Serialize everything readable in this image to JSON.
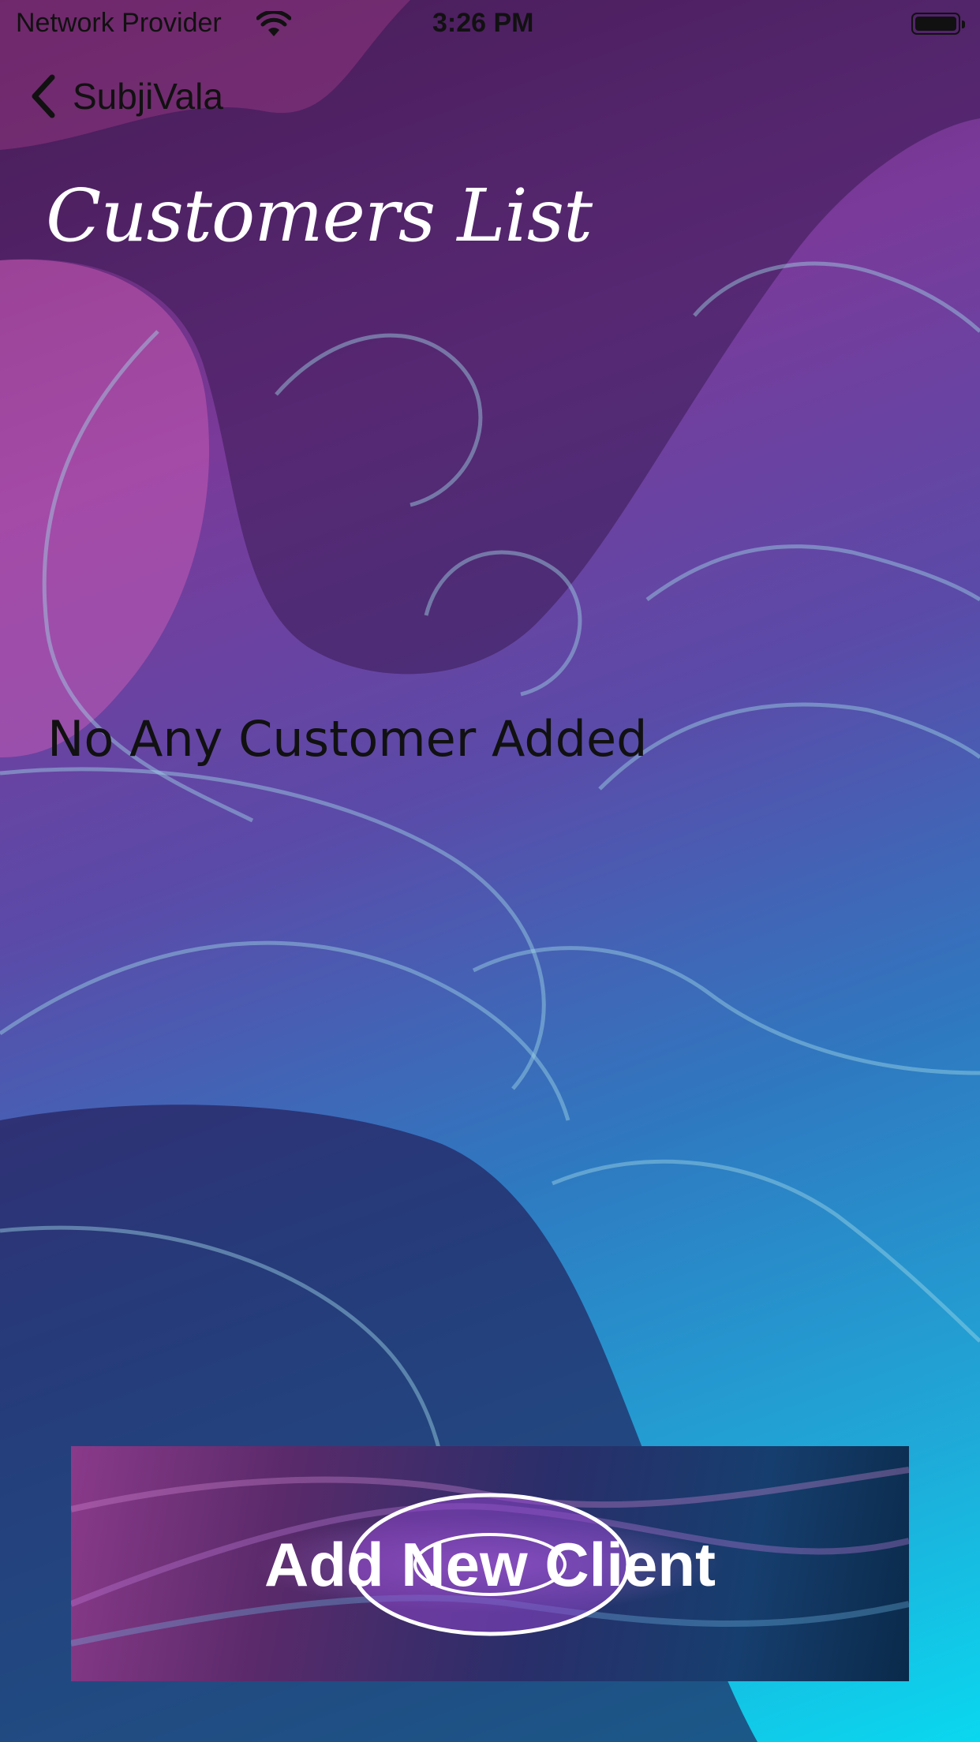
{
  "status_bar": {
    "carrier": "Network Provider",
    "time": "3:26 PM"
  },
  "nav": {
    "back_label": "SubjiVala"
  },
  "page": {
    "title": "Customers List",
    "empty_message": "No Any Customer Added"
  },
  "actions": {
    "add_client_label": "Add New Client"
  },
  "colors": {
    "title_text": "#ffffff",
    "body_text": "#111111",
    "gradient_top": "#5a1f5e",
    "gradient_bottom": "#0ad8ef"
  },
  "icons": {
    "back": "chevron-left-icon",
    "wifi": "wifi-icon",
    "battery": "battery-icon"
  }
}
